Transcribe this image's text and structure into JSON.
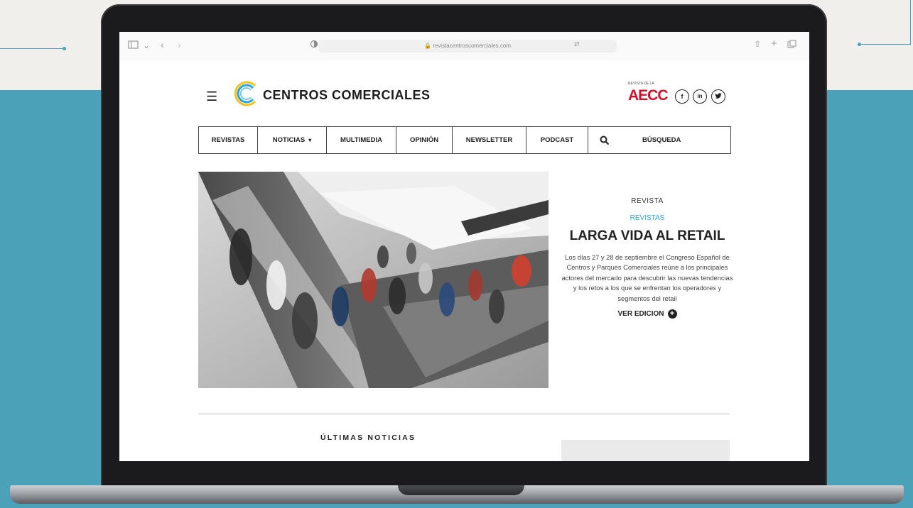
{
  "browser": {
    "url": "revistacentroscomerciales.com",
    "icons": [
      "sidebar-icon",
      "back-icon",
      "forward-icon",
      "privacy-icon",
      "translate-icon",
      "share-icon",
      "new-tab-icon",
      "tabs-icon"
    ]
  },
  "header": {
    "brand": "CENTROS COMERCIALES",
    "aecc_sub": "REVISTA DE LA",
    "aecc": "AECC",
    "social": [
      "f",
      "in",
      "t"
    ]
  },
  "nav": {
    "items": [
      "REVISTAS",
      "NOTICIAS",
      "MULTIMEDIA",
      "OPINIÓN",
      "NEWSLETTER",
      "PODCAST"
    ],
    "search_label": "BÚSQUEDA"
  },
  "hero": {
    "kicker": "REVISTA",
    "category": "REVISTAS",
    "title": "LARGA VIDA AL RETAIL",
    "summary": "Los días 27 y 28 de septiembre el Congreso Español de Centros y Parques Comerciales reúne a los principales actores del mercado para descubrir las nuevas tendencias y los retos a los que se enfrentan los operadores y segmentos del retail",
    "cta": "VER EDICION"
  },
  "section": {
    "latest_news": "ÚLTIMAS NOTICIAS"
  },
  "colors": {
    "accent": "#29a8d8",
    "aecc_red": "#d0102a",
    "background": "#4aa1b8"
  }
}
